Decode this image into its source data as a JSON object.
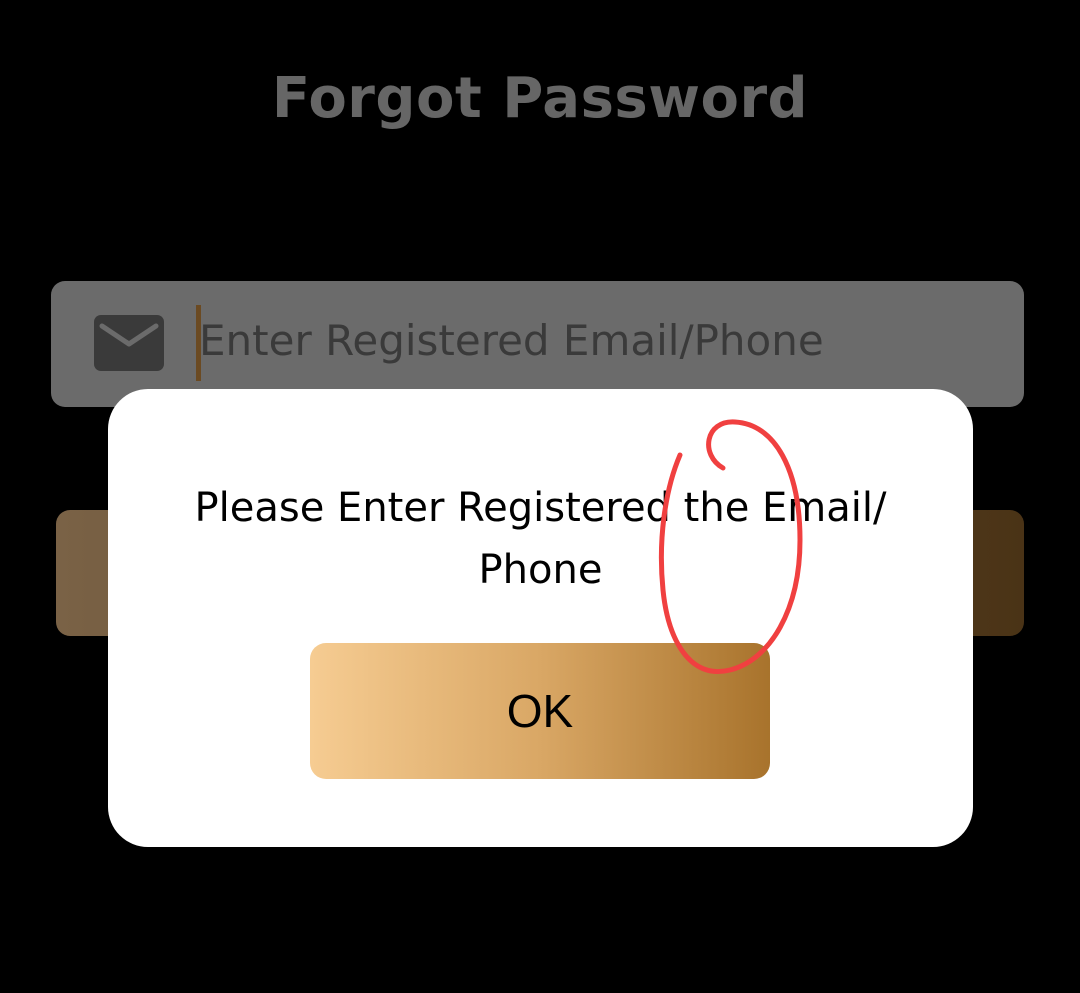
{
  "page": {
    "title": "Forgot Password"
  },
  "email_input": {
    "placeholder": "Enter Registered Email/Phone",
    "icon": "mail-icon"
  },
  "dialog": {
    "message": "Please Enter Registered the Email/ Phone",
    "ok_label": "OK"
  },
  "colors": {
    "background": "#000000",
    "title": "#666666",
    "input_bg": "#6b6b6b",
    "dialog_bg": "#ffffff",
    "button_gradient_start": "#f6cc92",
    "button_gradient_end": "#a8732c",
    "annotation": "#f04040"
  }
}
